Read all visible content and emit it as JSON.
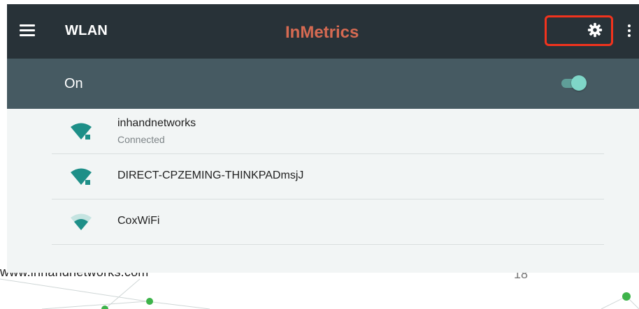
{
  "app_bar": {
    "title": "WLAN",
    "watermark": "InMetrics",
    "icons": [
      "menu-icon",
      "gear-icon",
      "overflow-menu-icon"
    ],
    "highlight_color": "#f2331d"
  },
  "wifi_switch": {
    "label": "On",
    "state": true,
    "accent": "#7fd6c8"
  },
  "networks": [
    {
      "ssid": "inhandnetworks",
      "status": "Connected",
      "secured": true,
      "signal": 4
    },
    {
      "ssid": "DIRECT-CPZEMING-THINKPADmsjJ",
      "status": "",
      "secured": true,
      "signal": 4
    },
    {
      "ssid": "CoxWiFi",
      "status": "",
      "secured": false,
      "signal": 3
    }
  ],
  "footer": {
    "url": "www.inhandnetworks.com",
    "page_number": "18"
  },
  "colors": {
    "app_bar": "#283238",
    "switch_bar": "#465a62",
    "wifi_icon": "#1e8f88",
    "list_bg": "#f2f5f5"
  }
}
